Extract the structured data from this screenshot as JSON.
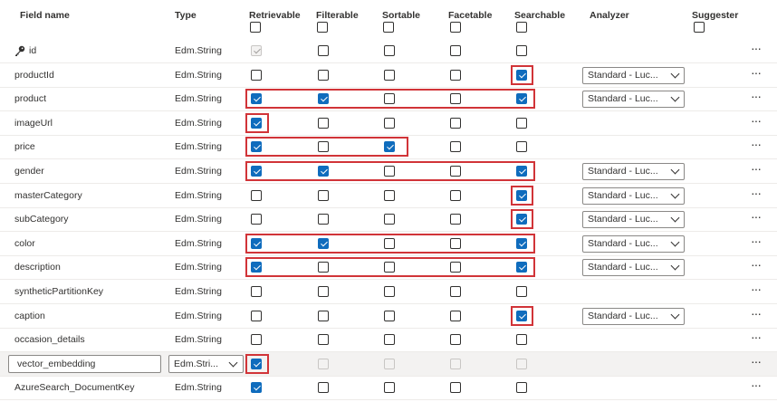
{
  "columns": {
    "field_name": "Field name",
    "type": "Type",
    "retrievable": "Retrievable",
    "filterable": "Filterable",
    "sortable": "Sortable",
    "facetable": "Facetable",
    "searchable": "Searchable",
    "analyzer": "Analyzer",
    "suggester": "Suggester"
  },
  "fields": [
    {
      "name": "id",
      "type": "Edm.String",
      "key": true,
      "retrievable": true,
      "filterable": false,
      "sortable": false,
      "facetable": false,
      "searchable": false,
      "retrievable_disabled": true,
      "analyzer": "",
      "highlight": null
    },
    {
      "name": "productId",
      "type": "Edm.String",
      "retrievable": false,
      "filterable": false,
      "sortable": false,
      "facetable": false,
      "searchable": true,
      "analyzer": "Standard - Luc...",
      "highlight": "searchable"
    },
    {
      "name": "product",
      "type": "Edm.String",
      "retrievable": true,
      "filterable": true,
      "sortable": false,
      "facetable": false,
      "searchable": true,
      "analyzer": "Standard - Luc...",
      "highlight": "retrievable-searchable"
    },
    {
      "name": "imageUrl",
      "type": "Edm.String",
      "retrievable": true,
      "filterable": false,
      "sortable": false,
      "facetable": false,
      "searchable": false,
      "analyzer": "",
      "highlight": "retrievable"
    },
    {
      "name": "price",
      "type": "Edm.String",
      "retrievable": true,
      "filterable": false,
      "sortable": true,
      "facetable": false,
      "searchable": false,
      "analyzer": "",
      "highlight": "retrievable-sortable"
    },
    {
      "name": "gender",
      "type": "Edm.String",
      "retrievable": true,
      "filterable": true,
      "sortable": false,
      "facetable": false,
      "searchable": true,
      "analyzer": "Standard - Luc...",
      "highlight": "retrievable-searchable"
    },
    {
      "name": "masterCategory",
      "type": "Edm.String",
      "retrievable": false,
      "filterable": false,
      "sortable": false,
      "facetable": false,
      "searchable": true,
      "analyzer": "Standard - Luc...",
      "highlight": "searchable"
    },
    {
      "name": "subCategory",
      "type": "Edm.String",
      "retrievable": false,
      "filterable": false,
      "sortable": false,
      "facetable": false,
      "searchable": true,
      "analyzer": "Standard - Luc...",
      "highlight": "searchable"
    },
    {
      "name": "color",
      "type": "Edm.String",
      "retrievable": true,
      "filterable": true,
      "sortable": false,
      "facetable": false,
      "searchable": true,
      "analyzer": "Standard - Luc...",
      "highlight": "retrievable-searchable"
    },
    {
      "name": "description",
      "type": "Edm.String",
      "retrievable": true,
      "filterable": false,
      "sortable": false,
      "facetable": false,
      "searchable": true,
      "analyzer": "Standard - Luc...",
      "highlight": "retrievable-searchable"
    },
    {
      "name": "syntheticPartitionKey",
      "type": "Edm.String",
      "retrievable": false,
      "filterable": false,
      "sortable": false,
      "facetable": false,
      "searchable": false,
      "analyzer": "",
      "highlight": null
    },
    {
      "name": "caption",
      "type": "Edm.String",
      "retrievable": false,
      "filterable": false,
      "sortable": false,
      "facetable": false,
      "searchable": true,
      "analyzer": "Standard - Luc...",
      "highlight": "searchable"
    },
    {
      "name": "occasion_details",
      "type": "Edm.String",
      "retrievable": false,
      "filterable": false,
      "sortable": false,
      "facetable": false,
      "searchable": false,
      "analyzer": "",
      "highlight": null
    },
    {
      "name": "vector_embedding",
      "type": "Edm.Stri...",
      "editing": true,
      "retrievable": true,
      "filterable": false,
      "sortable": false,
      "facetable": false,
      "searchable": false,
      "others_disabled": true,
      "analyzer": "",
      "highlight": "retrievable"
    },
    {
      "name": "AzureSearch_DocumentKey",
      "type": "Edm.String",
      "retrievable": true,
      "filterable": false,
      "sortable": false,
      "facetable": false,
      "searchable": false,
      "analyzer": "",
      "highlight": null
    }
  ],
  "more_glyph": "···",
  "highlight_color": "#d13438",
  "checkbox_color": "#0f6cbd"
}
